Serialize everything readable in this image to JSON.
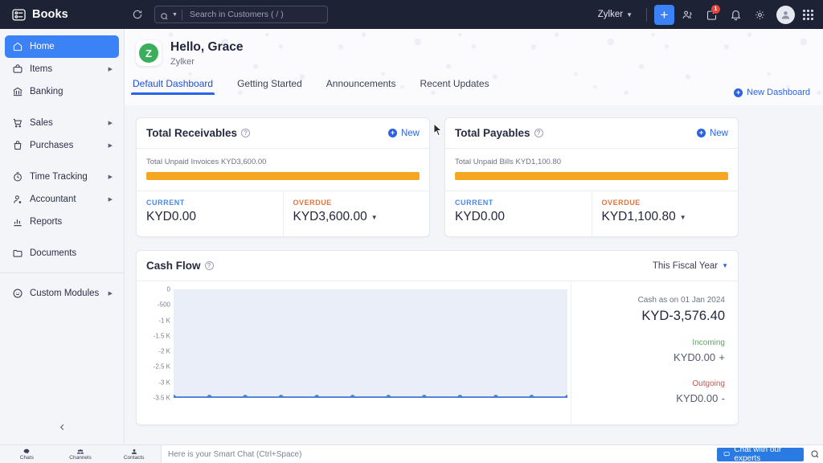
{
  "app": {
    "brand": "Books",
    "brand_icon": "books-logo-icon",
    "refresh_icon": "refresh-icon"
  },
  "search": {
    "placeholder": "Search in Customers ( / )",
    "value": "",
    "icon": "search-icon",
    "dropdown_icon": "chevron-down-icon"
  },
  "header_right": {
    "org": "Zylker",
    "org_caret": "chevron-down-icon",
    "add_button": "+",
    "icons": [
      {
        "name": "referral-users-icon",
        "badge": ""
      },
      {
        "name": "announcement-icon",
        "badge": "1"
      },
      {
        "name": "bell-icon",
        "badge": ""
      },
      {
        "name": "gear-icon",
        "badge": ""
      }
    ],
    "avatar": "user-avatar",
    "apps_icon": "app-grid-icon"
  },
  "sidebar": {
    "collapse_icon": "chevron-left-icon",
    "items": [
      {
        "label": "Home",
        "icon": "home-icon",
        "active": true,
        "arrow": false
      },
      {
        "label": "Items",
        "icon": "items-icon",
        "active": false,
        "arrow": true
      },
      {
        "label": "Banking",
        "icon": "bank-icon",
        "active": false,
        "arrow": false
      },
      {
        "label": "Sales",
        "icon": "cart-icon",
        "active": false,
        "arrow": true
      },
      {
        "label": "Purchases",
        "icon": "bag-icon",
        "active": false,
        "arrow": true
      },
      {
        "label": "Time Tracking",
        "icon": "timer-icon",
        "active": false,
        "arrow": true
      },
      {
        "label": "Accountant",
        "icon": "accountant-icon",
        "active": false,
        "arrow": true
      },
      {
        "label": "Reports",
        "icon": "reports-bar-icon",
        "active": false,
        "arrow": false
      },
      {
        "label": "Documents",
        "icon": "folder-icon",
        "active": false,
        "arrow": false
      },
      {
        "label": "Custom Modules",
        "icon": "custom-modules-icon",
        "active": false,
        "arrow": true
      }
    ]
  },
  "greeting": {
    "avatar_letter": "Z",
    "title": "Hello, Grace",
    "org": "Zylker"
  },
  "tabs": [
    {
      "label": "Default Dashboard",
      "active": true
    },
    {
      "label": "Getting Started",
      "active": false
    },
    {
      "label": "Announcements",
      "active": false
    },
    {
      "label": "Recent Updates",
      "active": false
    }
  ],
  "new_dashboard": {
    "label": "New Dashboard",
    "icon": "circle-plus-icon"
  },
  "receivables": {
    "title": "Total Receivables",
    "info_icon": "info-icon",
    "new_label": "New",
    "bar_label": "Total Unpaid Invoices KYD3,600.00",
    "bar_percent": 100,
    "current_label": "CURRENT",
    "current_value": "KYD0.00",
    "overdue_label": "OVERDUE",
    "overdue_value": "KYD3,600.00"
  },
  "payables": {
    "title": "Total Payables",
    "info_icon": "info-icon",
    "new_label": "New",
    "bar_label": "Total Unpaid Bills KYD1,100.80",
    "bar_percent": 100,
    "current_label": "CURRENT",
    "current_value": "KYD0.00",
    "overdue_label": "OVERDUE",
    "overdue_value": "KYD1,100.80"
  },
  "cash_flow": {
    "title": "Cash Flow",
    "info_icon": "info-icon",
    "period": "This Fiscal Year",
    "period_caret": "chevron-down-icon",
    "as_on_label": "Cash as on 01 Jan 2024",
    "as_on_value": "KYD-3,576.40",
    "incoming_label": "Incoming",
    "incoming_value": "KYD0.00",
    "incoming_sign": "+",
    "outgoing_label": "Outgoing",
    "outgoing_value": "KYD0.00",
    "outgoing_sign": "-"
  },
  "chart_data": {
    "type": "area",
    "title": "Cash Flow",
    "xlabel": "",
    "ylabel": "",
    "x": [
      1,
      2,
      3,
      4,
      5,
      6,
      7,
      8,
      9,
      10,
      11,
      12
    ],
    "categories": [
      "",
      "",
      "",
      "",
      "",
      "",
      "",
      "",
      "",
      "",
      "",
      ""
    ],
    "series": [
      {
        "name": "Cash Flow",
        "values": [
          -3576.4,
          -3576.4,
          -3576.4,
          -3576.4,
          -3576.4,
          -3576.4,
          -3576.4,
          -3576.4,
          -3576.4,
          -3576.4,
          -3576.4,
          -3576.4
        ],
        "color": "#4a7fd4",
        "fill": "#e9eef9"
      }
    ],
    "ytick_labels": [
      "0",
      "-500",
      "-1 K",
      "-1.5 K",
      "-2 K",
      "-2.5 K",
      "-3 K",
      "-3.5 K"
    ],
    "ytick_values": [
      0,
      -500,
      -1000,
      -1500,
      -2000,
      -2500,
      -3000,
      -3500
    ],
    "ylim": [
      -3600,
      0
    ],
    "grid": false,
    "legend": "none"
  },
  "bottom_bar": {
    "nav": [
      {
        "label": "Chats",
        "icon": "chats-icon"
      },
      {
        "label": "Channels",
        "icon": "channels-icon"
      },
      {
        "label": "Contacts",
        "icon": "contacts-icon"
      }
    ],
    "smart_chat_placeholder": "Here is your Smart Chat (Ctrl+Space)",
    "smart_chat_value": "",
    "expert_button": "Chat with our experts",
    "expert_icon": "chat-bubble-icon",
    "search_icon": "search-icon"
  }
}
